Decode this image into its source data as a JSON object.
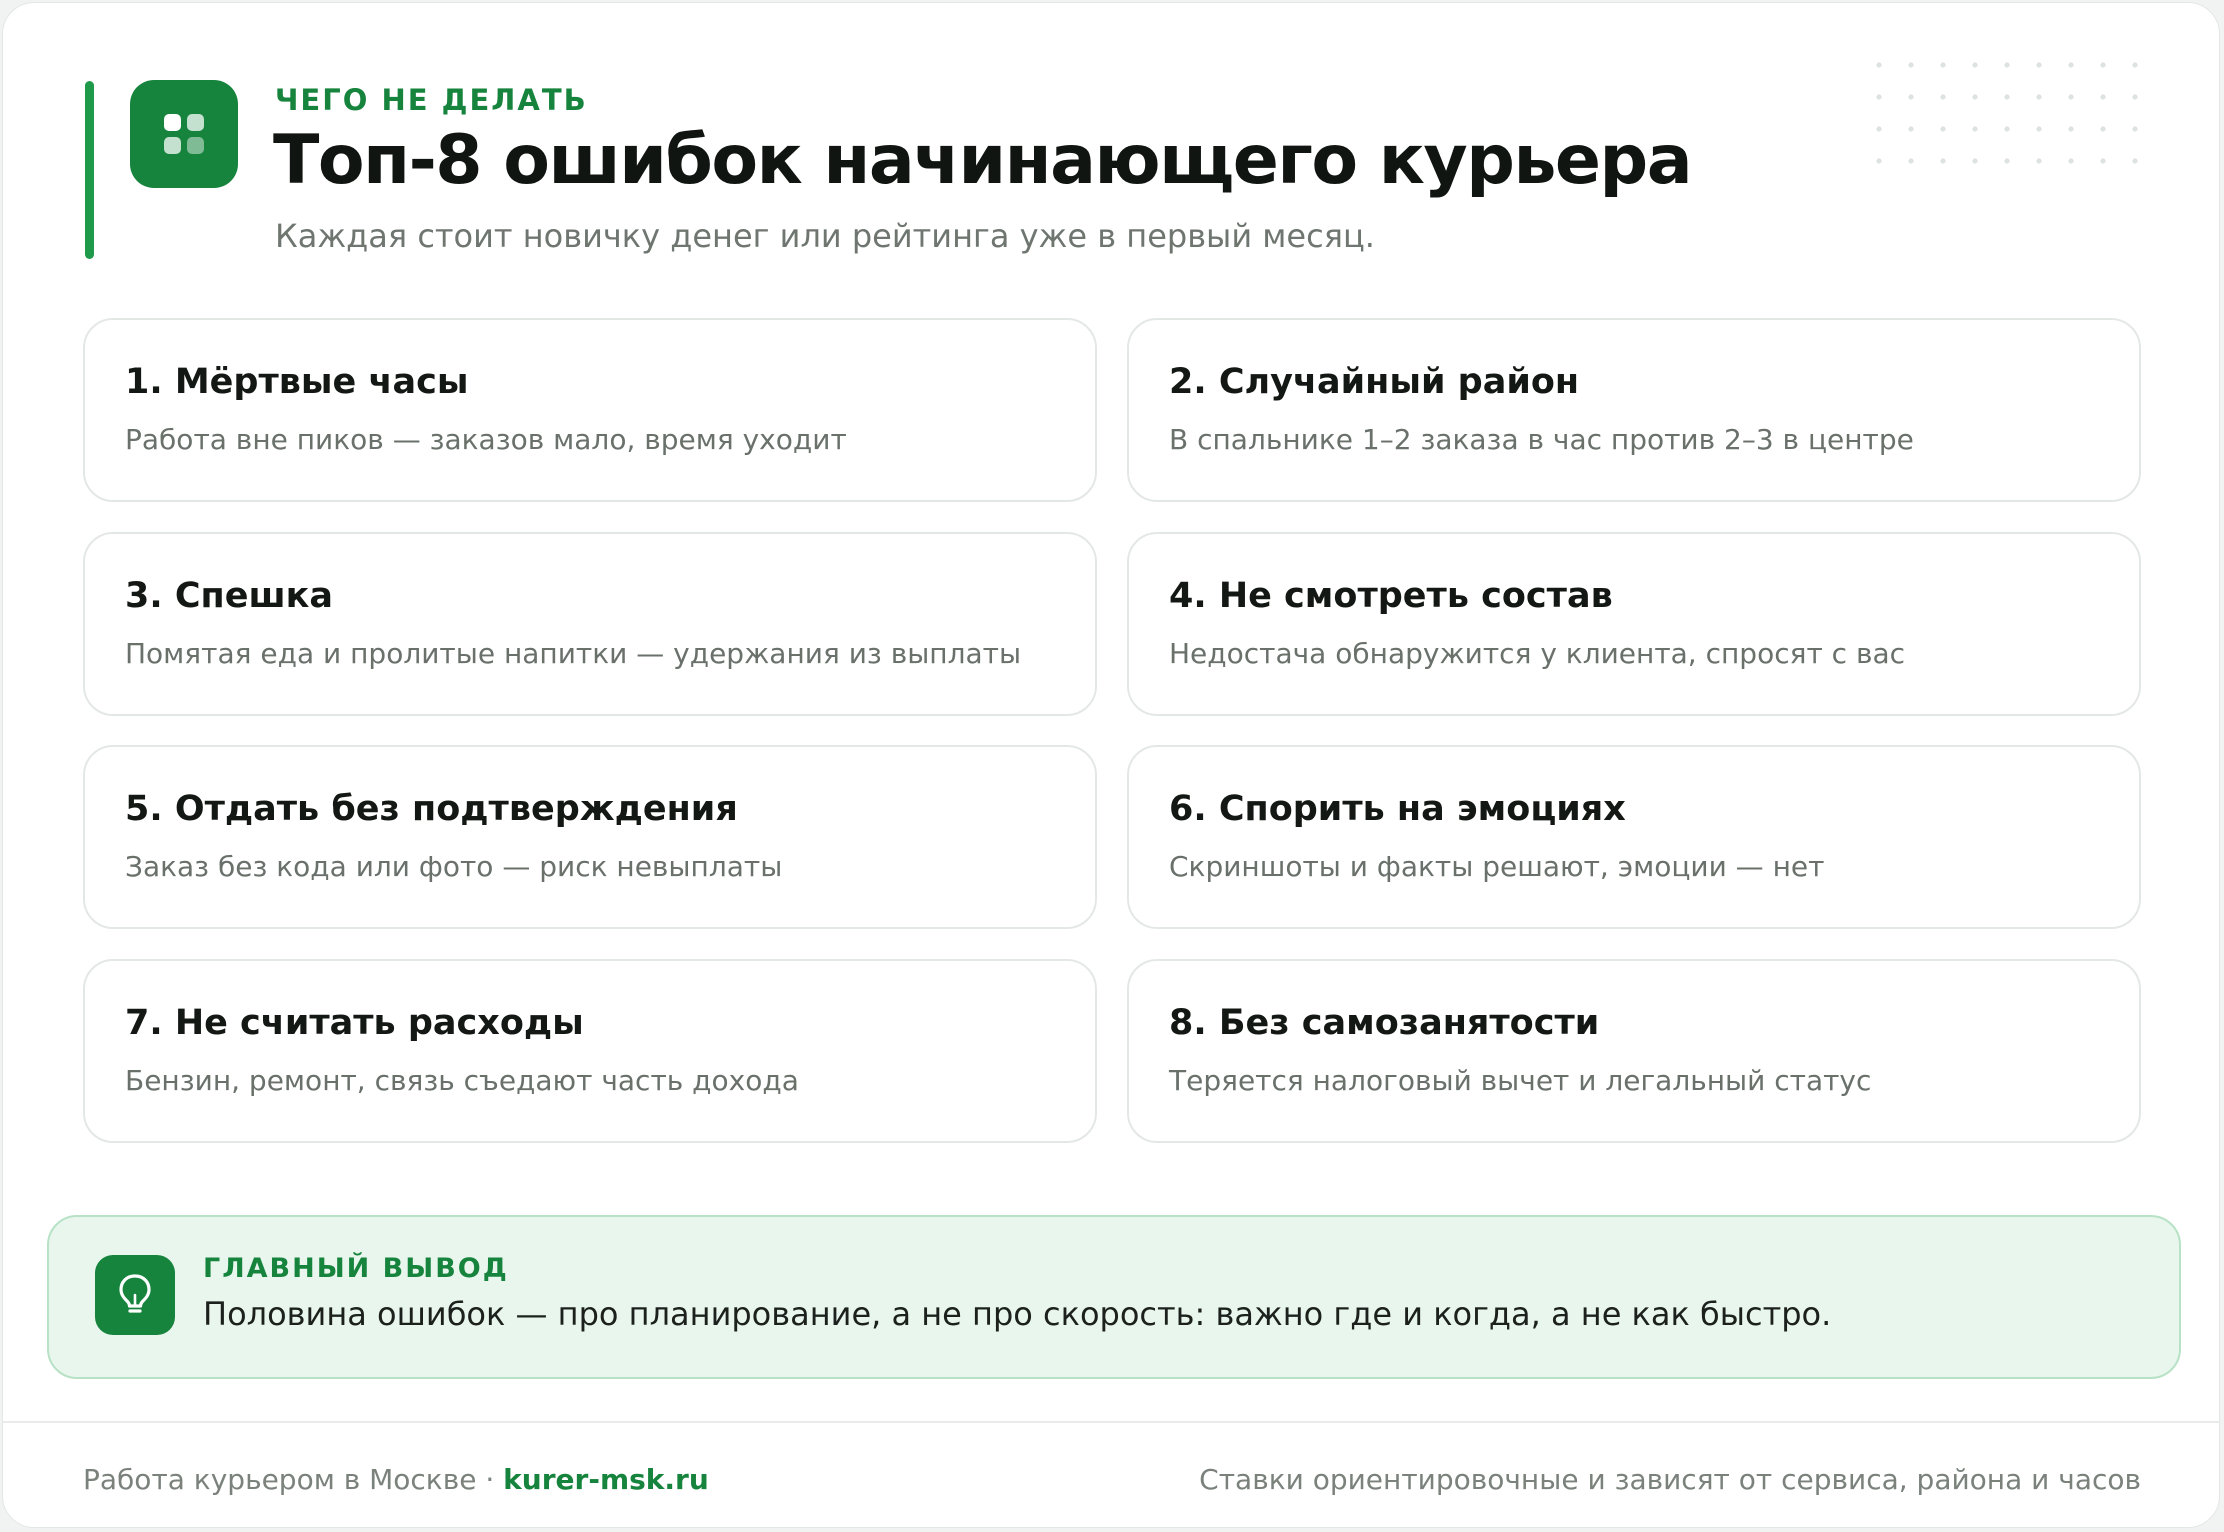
{
  "colors": {
    "accent": "#17843e",
    "accent_light": "#e9f6ee",
    "card_border": "#e4e8e5"
  },
  "header": {
    "icon": "grid-icon",
    "eyebrow": "ЧЕГО НЕ ДЕЛАТЬ",
    "title": "Топ-8 ошибок начинающего курьера",
    "subtitle": "Каждая стоит новичку денег или рейтинга уже в первый месяц."
  },
  "mistakes": [
    {
      "title": "1. Мёртвые часы",
      "desc": "Работа вне пиков — заказов мало, время уходит"
    },
    {
      "title": "2. Случайный район",
      "desc": "В спальнике 1–2 заказа в час против 2–3 в центре"
    },
    {
      "title": "3. Спешка",
      "desc": "Помятая еда и пролитые напитки — удержания из выплаты"
    },
    {
      "title": "4. Не смотреть состав",
      "desc": "Недостача обнаружится у клиента, спросят с вас"
    },
    {
      "title": "5. Отдать без подтверждения",
      "desc": "Заказ без кода или фото — риск невыплаты"
    },
    {
      "title": "6. Спорить на эмоциях",
      "desc": "Скриншоты и факты решают, эмоции — нет"
    },
    {
      "title": "7. Не считать расходы",
      "desc": "Бензин, ремонт, связь съедают часть дохода"
    },
    {
      "title": "8. Без самозанятости",
      "desc": "Теряется налоговый вычет и легальный статус"
    }
  ],
  "conclusion": {
    "icon": "lightbulb-icon",
    "label": "ГЛАВНЫЙ ВЫВОД",
    "text": "Половина ошибок — про планирование, а не про скорость: важно где и когда, а не как быстро."
  },
  "footer": {
    "left_text": "Работа курьером в Москве · ",
    "site": "kurer-msk.ru",
    "right_text": "Ставки ориентировочные и зависят от сервиса, района и часов"
  }
}
